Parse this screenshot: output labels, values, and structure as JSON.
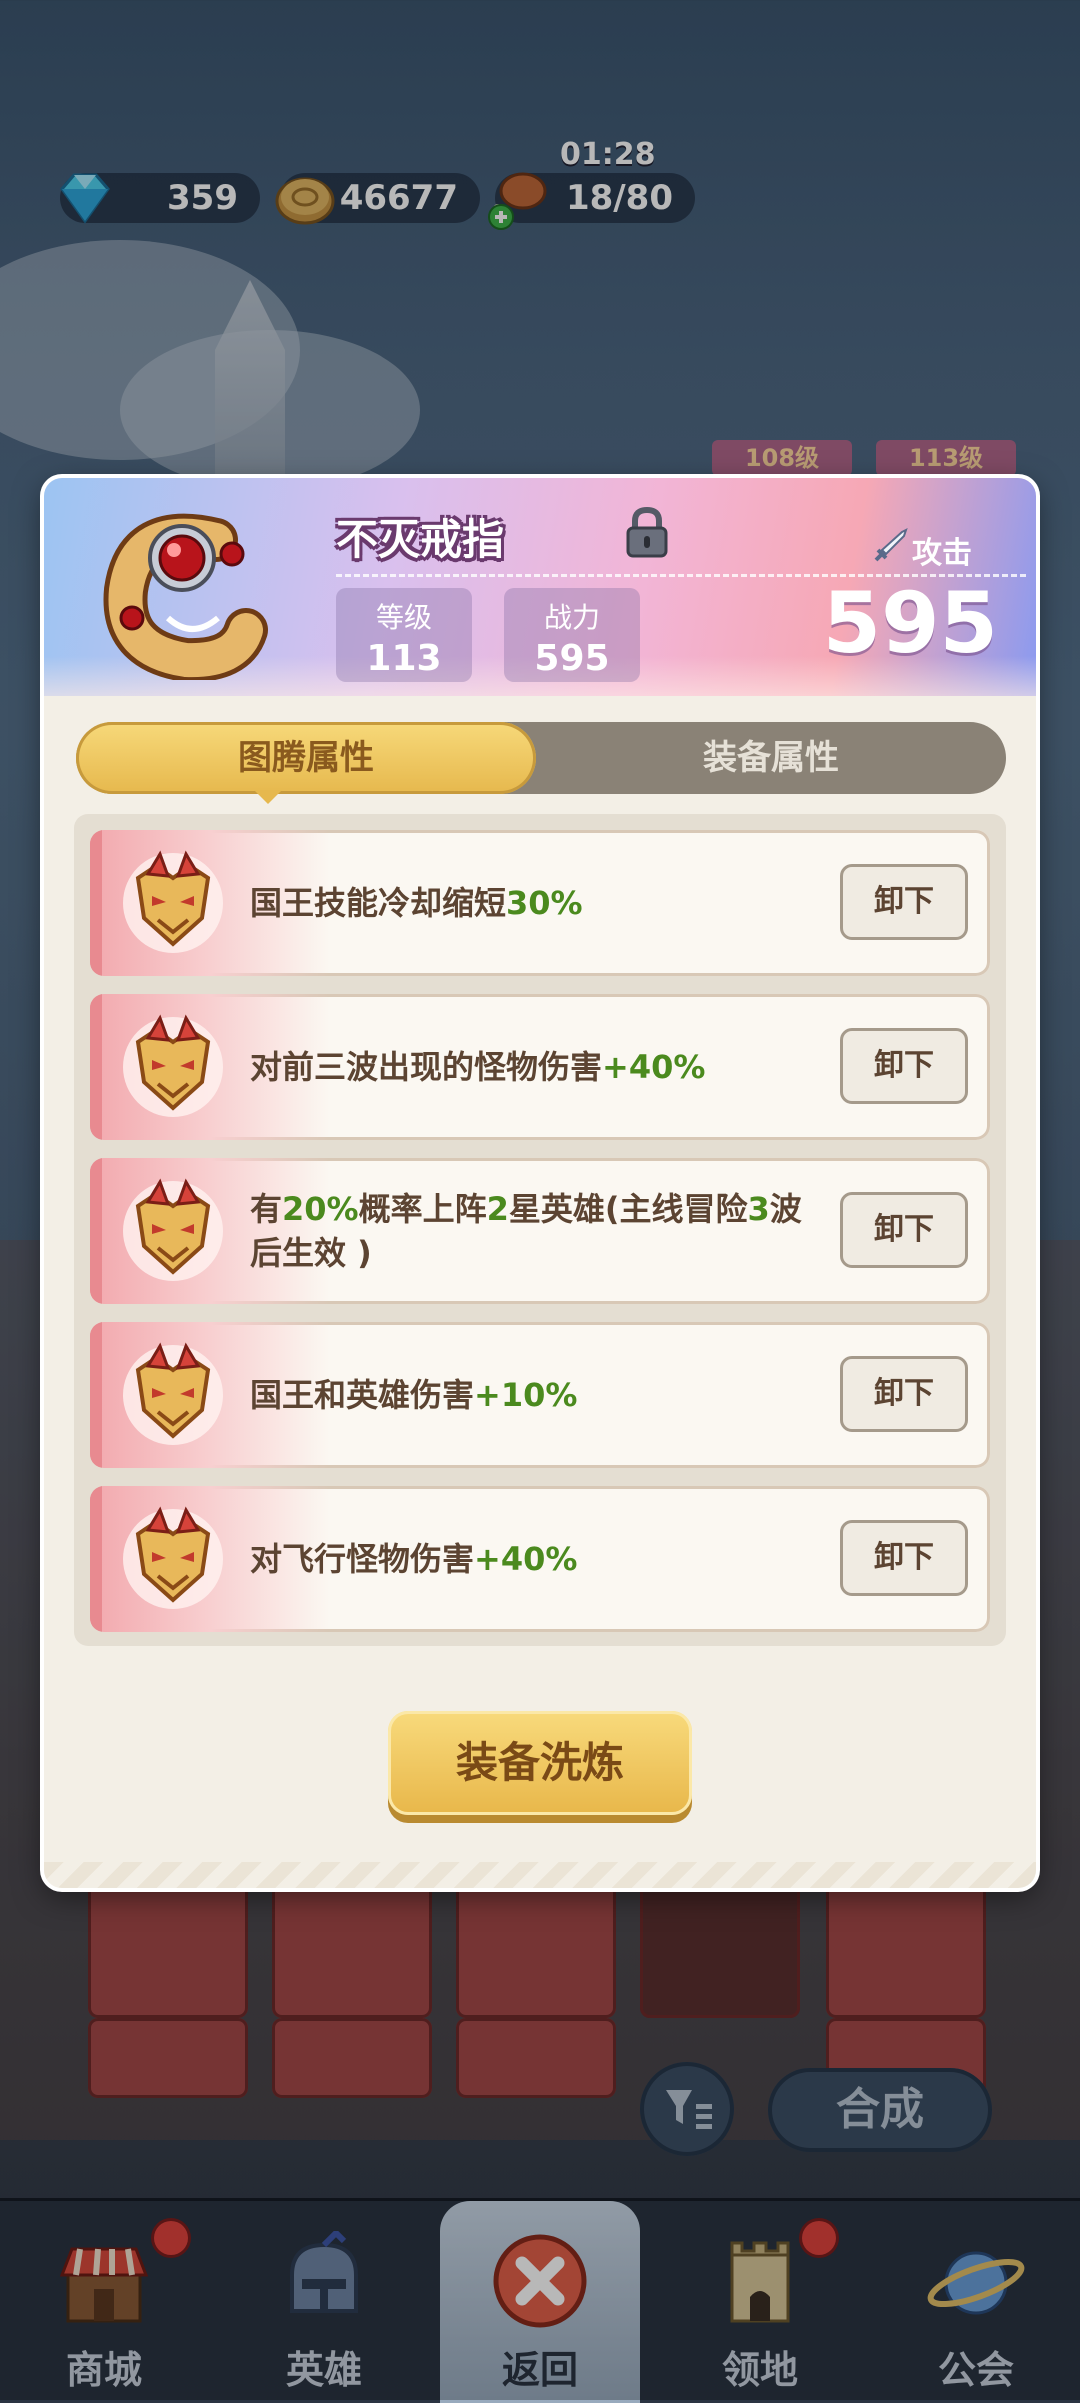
{
  "resources": {
    "gems": "359",
    "coins": "46677",
    "stamina": "18/80",
    "timer": "01:28"
  },
  "background": {
    "level_tags": [
      "108级",
      "113级"
    ]
  },
  "item": {
    "name": "不灭戒指",
    "locked": true,
    "level_label": "等级",
    "level_value": "113",
    "power_label": "战力",
    "power_value": "595",
    "attack_label": "攻击",
    "attack_value": "595"
  },
  "tabs": [
    {
      "label": "图腾属性",
      "active": true
    },
    {
      "label": "装备属性",
      "active": false
    }
  ],
  "attributes": [
    {
      "prefix": "国王技能冷却缩短",
      "hl1": "30%",
      "mid": "",
      "hl2": "",
      "mid2": "",
      "hl3": "",
      "suffix": "",
      "button": "卸下"
    },
    {
      "prefix": "对前三波出现的怪物伤害",
      "hl1": "+40%",
      "mid": "",
      "hl2": "",
      "mid2": "",
      "hl3": "",
      "suffix": "",
      "button": "卸下"
    },
    {
      "prefix": "有",
      "hl1": "20%",
      "mid": "概率上阵",
      "hl2": "2",
      "mid2": "星英雄(主线冒险",
      "hl3": "3",
      "suffix": "波后生效 )",
      "button": "卸下"
    },
    {
      "prefix": "国王和英雄伤害",
      "hl1": "+10%",
      "mid": "",
      "hl2": "",
      "mid2": "",
      "hl3": "",
      "suffix": "",
      "button": "卸下"
    },
    {
      "prefix": "对飞行怪物伤害",
      "hl1": "+40%",
      "mid": "",
      "hl2": "",
      "mid2": "",
      "hl3": "",
      "suffix": "",
      "button": "卸下"
    }
  ],
  "refine_button": "装备洗炼",
  "merge_button": "合成",
  "nav": [
    {
      "label": "商城",
      "icon": "shop-icon",
      "badge": true
    },
    {
      "label": "英雄",
      "icon": "helmet-icon",
      "badge": false
    },
    {
      "label": "返回",
      "icon": "close-icon",
      "badge": false,
      "active": true
    },
    {
      "label": "领地",
      "icon": "castle-icon",
      "badge": true
    },
    {
      "label": "公会",
      "icon": "planet-icon",
      "badge": false
    }
  ],
  "colors": {
    "highlight_green": "#4b8a1e",
    "button_gold": "#e8b74a",
    "text_brown": "#5c4432"
  }
}
